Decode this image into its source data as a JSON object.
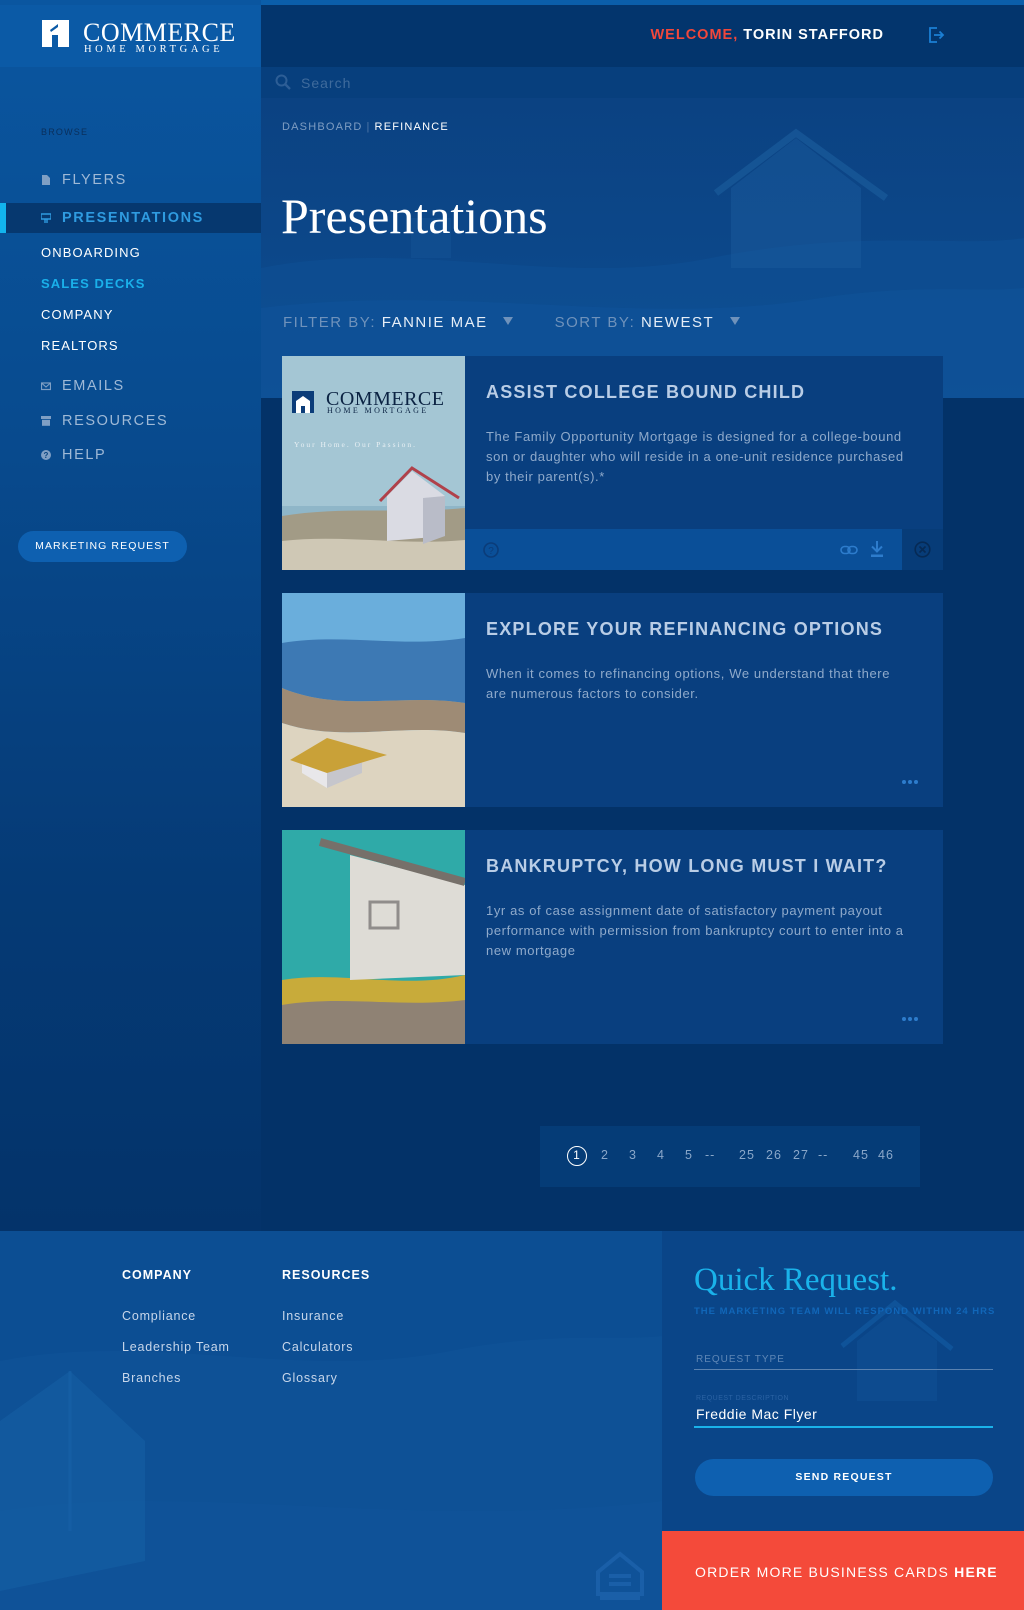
{
  "brand": {
    "name_line1": "COMMERCE",
    "name_line2": "HOME MORTGAGE",
    "accent": "#f44a3a",
    "highlight": "#1ab2ea"
  },
  "header": {
    "welcome_prefix": "WELCOME,",
    "user_name": "TORIN STAFFORD",
    "logout_icon": "logout-icon"
  },
  "search": {
    "placeholder": "Search"
  },
  "sidebar": {
    "browse_label": "BROWSE",
    "items": [
      {
        "label": "FLYERS",
        "icon": "document-icon"
      },
      {
        "label": "PRESENTATIONS",
        "icon": "presentation-icon",
        "active": true
      },
      {
        "label": "EMAILS",
        "icon": "envelope-icon"
      },
      {
        "label": "RESOURCES",
        "icon": "archive-icon"
      },
      {
        "label": "HELP",
        "icon": "help-icon"
      }
    ],
    "sub_items": [
      {
        "label": "ONBOARDING"
      },
      {
        "label": "SALES DECKS",
        "current": true
      },
      {
        "label": "COMPANY"
      },
      {
        "label": "REALTORS"
      }
    ],
    "marketing_request_label": "MARKETING REQUEST"
  },
  "breadcrumb": {
    "root": "DASHBOARD",
    "separator": "|",
    "current": "REFINANCE"
  },
  "page_title": "Presentations",
  "filters": {
    "filter_label": "FILTER BY:",
    "filter_value": "FANNIE MAE",
    "sort_label": "SORT BY:",
    "sort_value": "NEWEST"
  },
  "cards": [
    {
      "title": "ASSIST COLLEGE BOUND CHILD",
      "description": "The Family Opportunity Mortgage is designed for a college-bound son or daughter who will reside in a one-unit residence purchased by their parent(s).*",
      "thumb_logo_line1": "COMMERCE",
      "thumb_logo_line2": "HOME MORTGAGE",
      "thumb_tagline": "Your Home.  Our Passion."
    },
    {
      "title": "EXPLORE YOUR REFINANCING OPTIONS",
      "description": "When it comes to refinancing options, We understand that there are numerous factors to consider."
    },
    {
      "title": "BANKRUPTCY, HOW LONG MUST I WAIT?",
      "description": "1yr as of case assignment date of satisfactory payment payout performance with permission from bankruptcy court to enter into a new mortgage"
    }
  ],
  "pagination": {
    "current": "1",
    "pages": [
      "2",
      "3",
      "4",
      "5",
      "--",
      "25",
      "26",
      "27",
      "--",
      "45",
      "46"
    ]
  },
  "footer": {
    "company_title": "COMPANY",
    "company_links": [
      "Compliance",
      "Leadership Team",
      "Branches"
    ],
    "resources_title": "RESOURCES",
    "resources_links": [
      "Insurance",
      "Calculators",
      "Glossary"
    ],
    "equal_housing_icon": "equal-housing-icon"
  },
  "quick_request": {
    "title": "Quick Request.",
    "subtitle": "THE MARKETING TEAM WILL RESPOND WITHIN 24 HRS",
    "request_type_label": "REQUEST TYPE",
    "request_description_label": "REQUEST DESCRIPTION",
    "request_description_value": "Freddie Mac Flyer",
    "send_label": "SEND REQUEST"
  },
  "order_cards": {
    "text": "ORDER MORE BUSINESS CARDS",
    "link": "HERE"
  }
}
